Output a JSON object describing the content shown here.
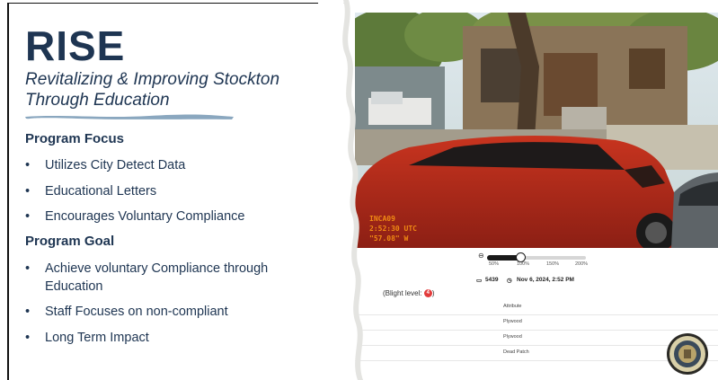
{
  "slide": {
    "title": "RISE",
    "subtitle": "Revitalizing & Improving Stockton Through Education",
    "focus": {
      "heading": "Program Focus",
      "items": [
        "Utilizes City Detect Data",
        "Educational Letters",
        "Encourages Voluntary Compliance"
      ]
    },
    "goal": {
      "heading": "Program Goal",
      "items": [
        "Achieve voluntary Compliance through Education",
        "Staff Focuses on non-compliant",
        "Long Term Impact"
      ]
    },
    "bullet_char": "•"
  },
  "screenshot": {
    "overlay": {
      "line1": "INCA09",
      "line2": "2:52:30 UTC",
      "line3": "\"57.08\" W"
    },
    "zoom": {
      "minus_label": "⊖",
      "levels": [
        "50%",
        "100%",
        "150%",
        "200%"
      ],
      "value_fraction": 0.33
    },
    "meta": {
      "image_icon": "image-icon",
      "image_count": "5439",
      "clock_icon": "clock-icon",
      "datetime": "Nov 6, 2024, 2:52 PM"
    },
    "blight": {
      "label": "(Blight level:",
      "level": "4",
      "close": ")"
    },
    "table": {
      "header": "Attribute",
      "rows": [
        "Plywood",
        "Plywood",
        "Dead Patch"
      ]
    }
  },
  "colors": {
    "navy": "#1e3552",
    "brush": "#8aa7bf",
    "badge": "#e23b3b",
    "overlay": "#f08a14",
    "car": "#b52a1c"
  }
}
